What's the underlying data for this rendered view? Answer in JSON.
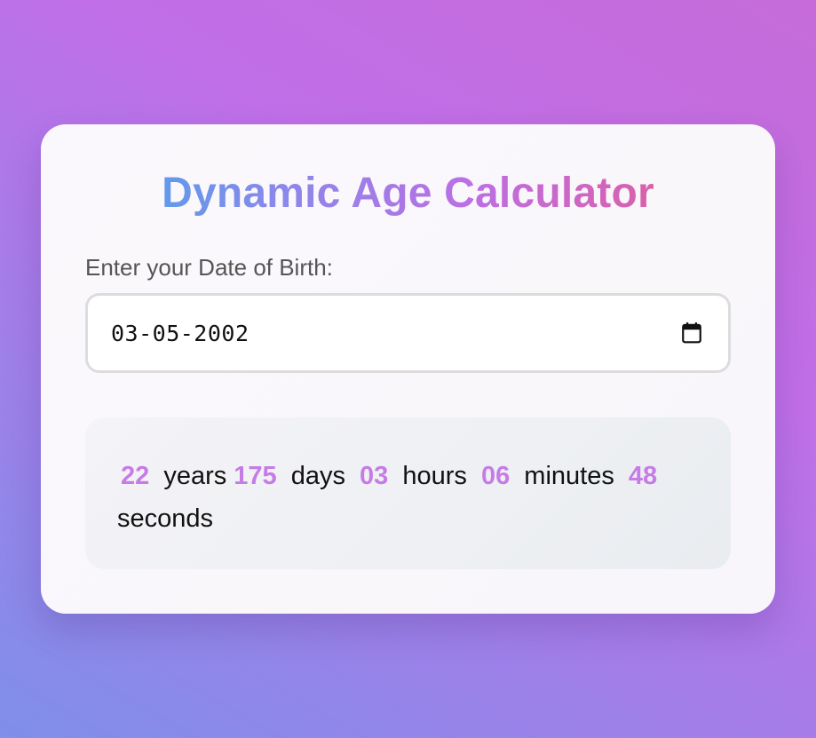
{
  "app": {
    "title": "Dynamic Age Calculator"
  },
  "form": {
    "label": "Enter your Date of Birth:",
    "date_value": "03-05-2002",
    "calendar_icon": "calendar-icon"
  },
  "result": {
    "years_value": "22",
    "years_label": "years",
    "days_value": "175",
    "days_label": "days",
    "hours_value": "03",
    "hours_label": "hours",
    "minutes_value": "06",
    "minutes_label": "minutes",
    "seconds_value": "48",
    "seconds_label": "seconds"
  },
  "colors": {
    "accent_number": "#c57ce6",
    "title_gradient_start": "#47a6e8",
    "title_gradient_end": "#e75a93"
  }
}
